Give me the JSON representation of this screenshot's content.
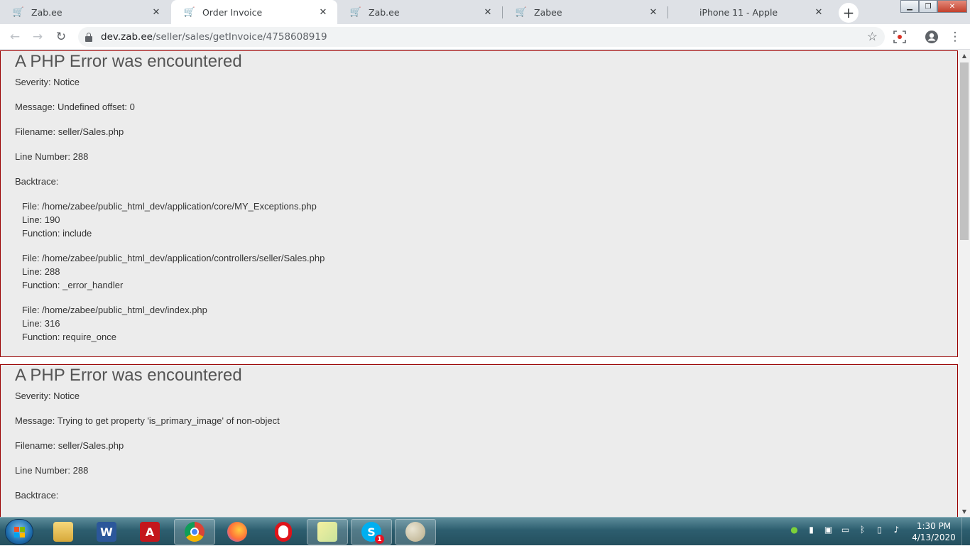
{
  "browser": {
    "tabs": [
      {
        "title": "Zab.ee",
        "icon": "cart-icon",
        "active": false
      },
      {
        "title": "Order Invoice",
        "icon": "cart-icon",
        "active": true
      },
      {
        "title": "Zab.ee",
        "icon": "cart-icon",
        "active": false
      },
      {
        "title": "Zabee",
        "icon": "cart-icon",
        "active": false
      },
      {
        "title": "iPhone 11 - Apple",
        "icon": "apple-icon",
        "active": false
      }
    ],
    "url_host": "dev.zab.ee",
    "url_path": "/seller/sales/getInvoice/4758608919"
  },
  "errors": [
    {
      "heading": "A PHP Error was encountered",
      "severity": "Severity: Notice",
      "message": "Message: Undefined offset: 0",
      "filename": "Filename: seller/Sales.php",
      "line_number": "Line Number: 288",
      "backtrace_label": "Backtrace:",
      "backtrace": [
        {
          "file": "File: /home/zabee/public_html_dev/application/core/MY_Exceptions.php",
          "line": "Line: 190",
          "function": "Function: include"
        },
        {
          "file": "File: /home/zabee/public_html_dev/application/controllers/seller/Sales.php",
          "line": "Line: 288",
          "function": "Function: _error_handler"
        },
        {
          "file": "File: /home/zabee/public_html_dev/index.php",
          "line": "Line: 316",
          "function": "Function: require_once"
        }
      ]
    },
    {
      "heading": "A PHP Error was encountered",
      "severity": "Severity: Notice",
      "message": "Message: Trying to get property 'is_primary_image' of non-object",
      "filename": "Filename: seller/Sales.php",
      "line_number": "Line Number: 288",
      "backtrace_label": "Backtrace:"
    }
  ],
  "taskbar": {
    "apps": [
      "explorer-icon",
      "word-icon",
      "acrobat-icon",
      "chrome-icon",
      "firefox-icon",
      "opera-icon",
      "sticky-notes-icon",
      "skype-icon",
      "paint-icon"
    ],
    "skype_badge": "1",
    "time": "1:30 PM",
    "date": "4/13/2020"
  },
  "colors": {
    "error_border": "#990000",
    "error_bg": "#ececec",
    "tabstrip_bg": "#dee1e6"
  }
}
